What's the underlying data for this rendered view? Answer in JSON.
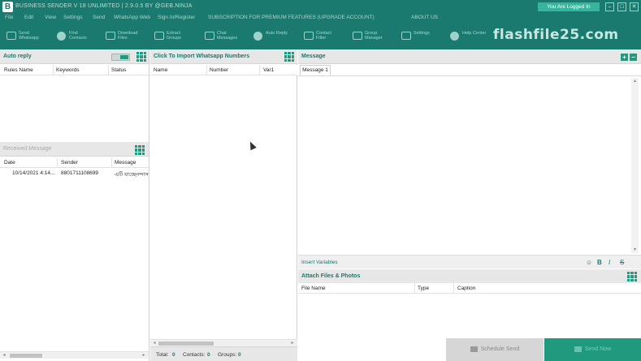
{
  "app": {
    "logo_letter": "B",
    "title": "BUSINESS SENDER V 18 UNLIMITED | 2.9.0.5 BY @GEB.NINJA",
    "login_status": "You Are Logged In",
    "window_controls": {
      "minimize": "–",
      "maximize": "□",
      "close": "✕"
    }
  },
  "menu": [
    "File",
    "Edit",
    "View",
    "Settings",
    "Send",
    "WhatsApp Web",
    "Sign In/Register",
    "SUBSCRIPTION FOR PREMIUM FEATURES (UPGRADE ACCOUNT)",
    "ABOUT US"
  ],
  "toolbar": [
    {
      "label": "Send\nWhatsapp",
      "icon": "send-icon"
    },
    {
      "label": "Find\nContacts",
      "icon": "contacts-icon"
    },
    {
      "label": "Download\nFiles",
      "icon": "download-icon"
    },
    {
      "label": "Extract\nGroups",
      "icon": "group-icon"
    },
    {
      "label": "Chat\nMessages",
      "icon": "chat-icon"
    },
    {
      "label": "Auto Reply",
      "icon": "headset-icon"
    },
    {
      "label": "Contact\nFilter",
      "icon": "filter-icon"
    },
    {
      "label": "Group\nManager",
      "icon": "grid-icon"
    },
    {
      "label": "Settings",
      "icon": "settings-icon"
    },
    {
      "label": "Help Center",
      "icon": "cloud-icon"
    }
  ],
  "watermark": "flashfile25.com",
  "auto_reply": {
    "title": "Auto reply",
    "columns": [
      "Rules Name",
      "Keywords",
      "Status"
    ]
  },
  "received": {
    "title": "Received Message",
    "columns": [
      "Date",
      "Sender",
      "Message"
    ],
    "rows": [
      {
        "date": "10/14/2021 4:14...",
        "sender": "8801711108699",
        "message": "এটি যাচ্ছেনন্দাস"
      }
    ]
  },
  "import": {
    "title": "Click To Import Whatsapp Numbers",
    "columns": [
      "Name",
      "Number",
      "Var1"
    ],
    "footer": {
      "total_label": "Total:",
      "total": "0",
      "contacts_label": "Contacts:",
      "contacts": "0",
      "groups_label": "Groups:",
      "groups": "0"
    }
  },
  "message": {
    "title": "Message",
    "add": "+",
    "remove": "−",
    "tab": "Message 1",
    "insert_variables": "Insert Variables",
    "format": {
      "bold": "B",
      "italic": "I",
      "strike": "S"
    }
  },
  "attach": {
    "title": "Attach Files & Photos",
    "columns": [
      "File Name",
      "Type",
      "Caption"
    ]
  },
  "actions": {
    "schedule": "Schedule Send",
    "send_now": "Send Now"
  }
}
